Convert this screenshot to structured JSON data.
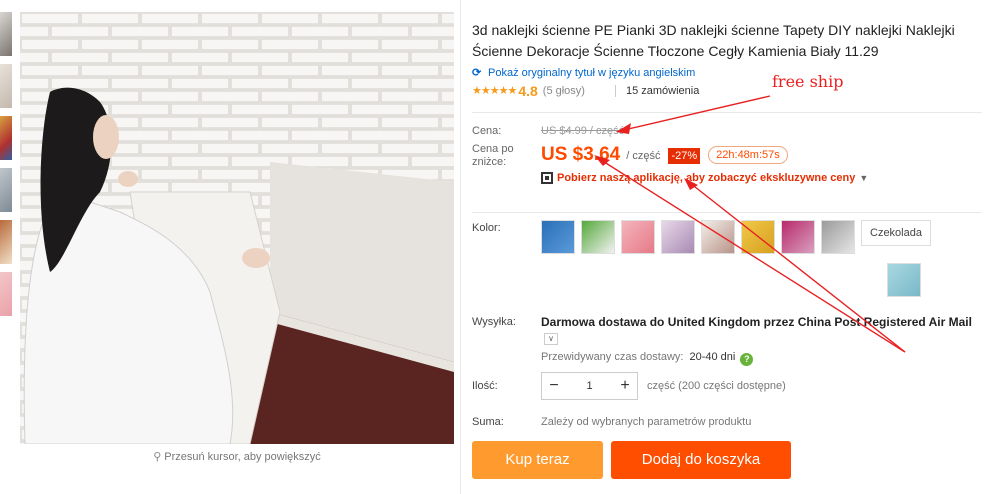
{
  "gallery": {
    "zoom_hint": "Przesuń kursor, aby powiększyć",
    "search_icon": "magnifier-icon"
  },
  "product": {
    "title": "3d naklejki ścienne PE Pianki 3D naklejki ścienne Tapety DIY naklejki Naklejki Ścienne Dekoracje Ścienne Tłoczone Cegły Kamienia Biały 11.29",
    "translate_link": "Pokaż oryginalny tytuł w języku angielskim",
    "rating_stars": "★★★★★",
    "rating_value": "4.8",
    "votes": "(5 głosy)",
    "orders": "15 zamówienia"
  },
  "price": {
    "original_label": "Cena:",
    "original_price": "US $4.99 / część",
    "current_label": "Cena po zniżce:",
    "current_price": "US $3.64",
    "unit": "/ część",
    "discount": "-27%",
    "countdown": "22h:48m:57s",
    "app_promo": "Pobierz naszą aplikację, aby zobaczyć ekskluzywne ceny"
  },
  "color": {
    "label": "Kolor:",
    "text_option": "Czekolada",
    "swatches": [
      "blue-brick",
      "green-wall",
      "pink-brick",
      "purple-brick",
      "white-brick",
      "yellow-brick",
      "magenta-brick",
      "grey-brick",
      "light-blue-brick"
    ]
  },
  "shipping": {
    "label": "Wysyłka:",
    "method": "Darmowa dostawa do United Kingdom przez China Post Registered Air Mail",
    "estimate_label": "Przewidywany czas dostawy:",
    "estimate_days": "20-40 dni"
  },
  "quantity": {
    "label": "Ilość:",
    "value": "1",
    "minus": "−",
    "plus": "+",
    "available": "część (200 części dostępne)"
  },
  "total": {
    "label": "Suma:",
    "value": "Zależy od wybranych parametrów produktu"
  },
  "actions": {
    "buy_now": "Kup teraz",
    "add_to_cart": "Dodaj do koszyka"
  },
  "annotation": {
    "text": "free ship",
    "color": "#e82020"
  },
  "colors": {
    "accent": "#ff4b00",
    "buy_button": "#ff9a2e",
    "cart_button": "#ff4e00",
    "discount_badge": "#e62e04",
    "link": "#0066cc"
  }
}
